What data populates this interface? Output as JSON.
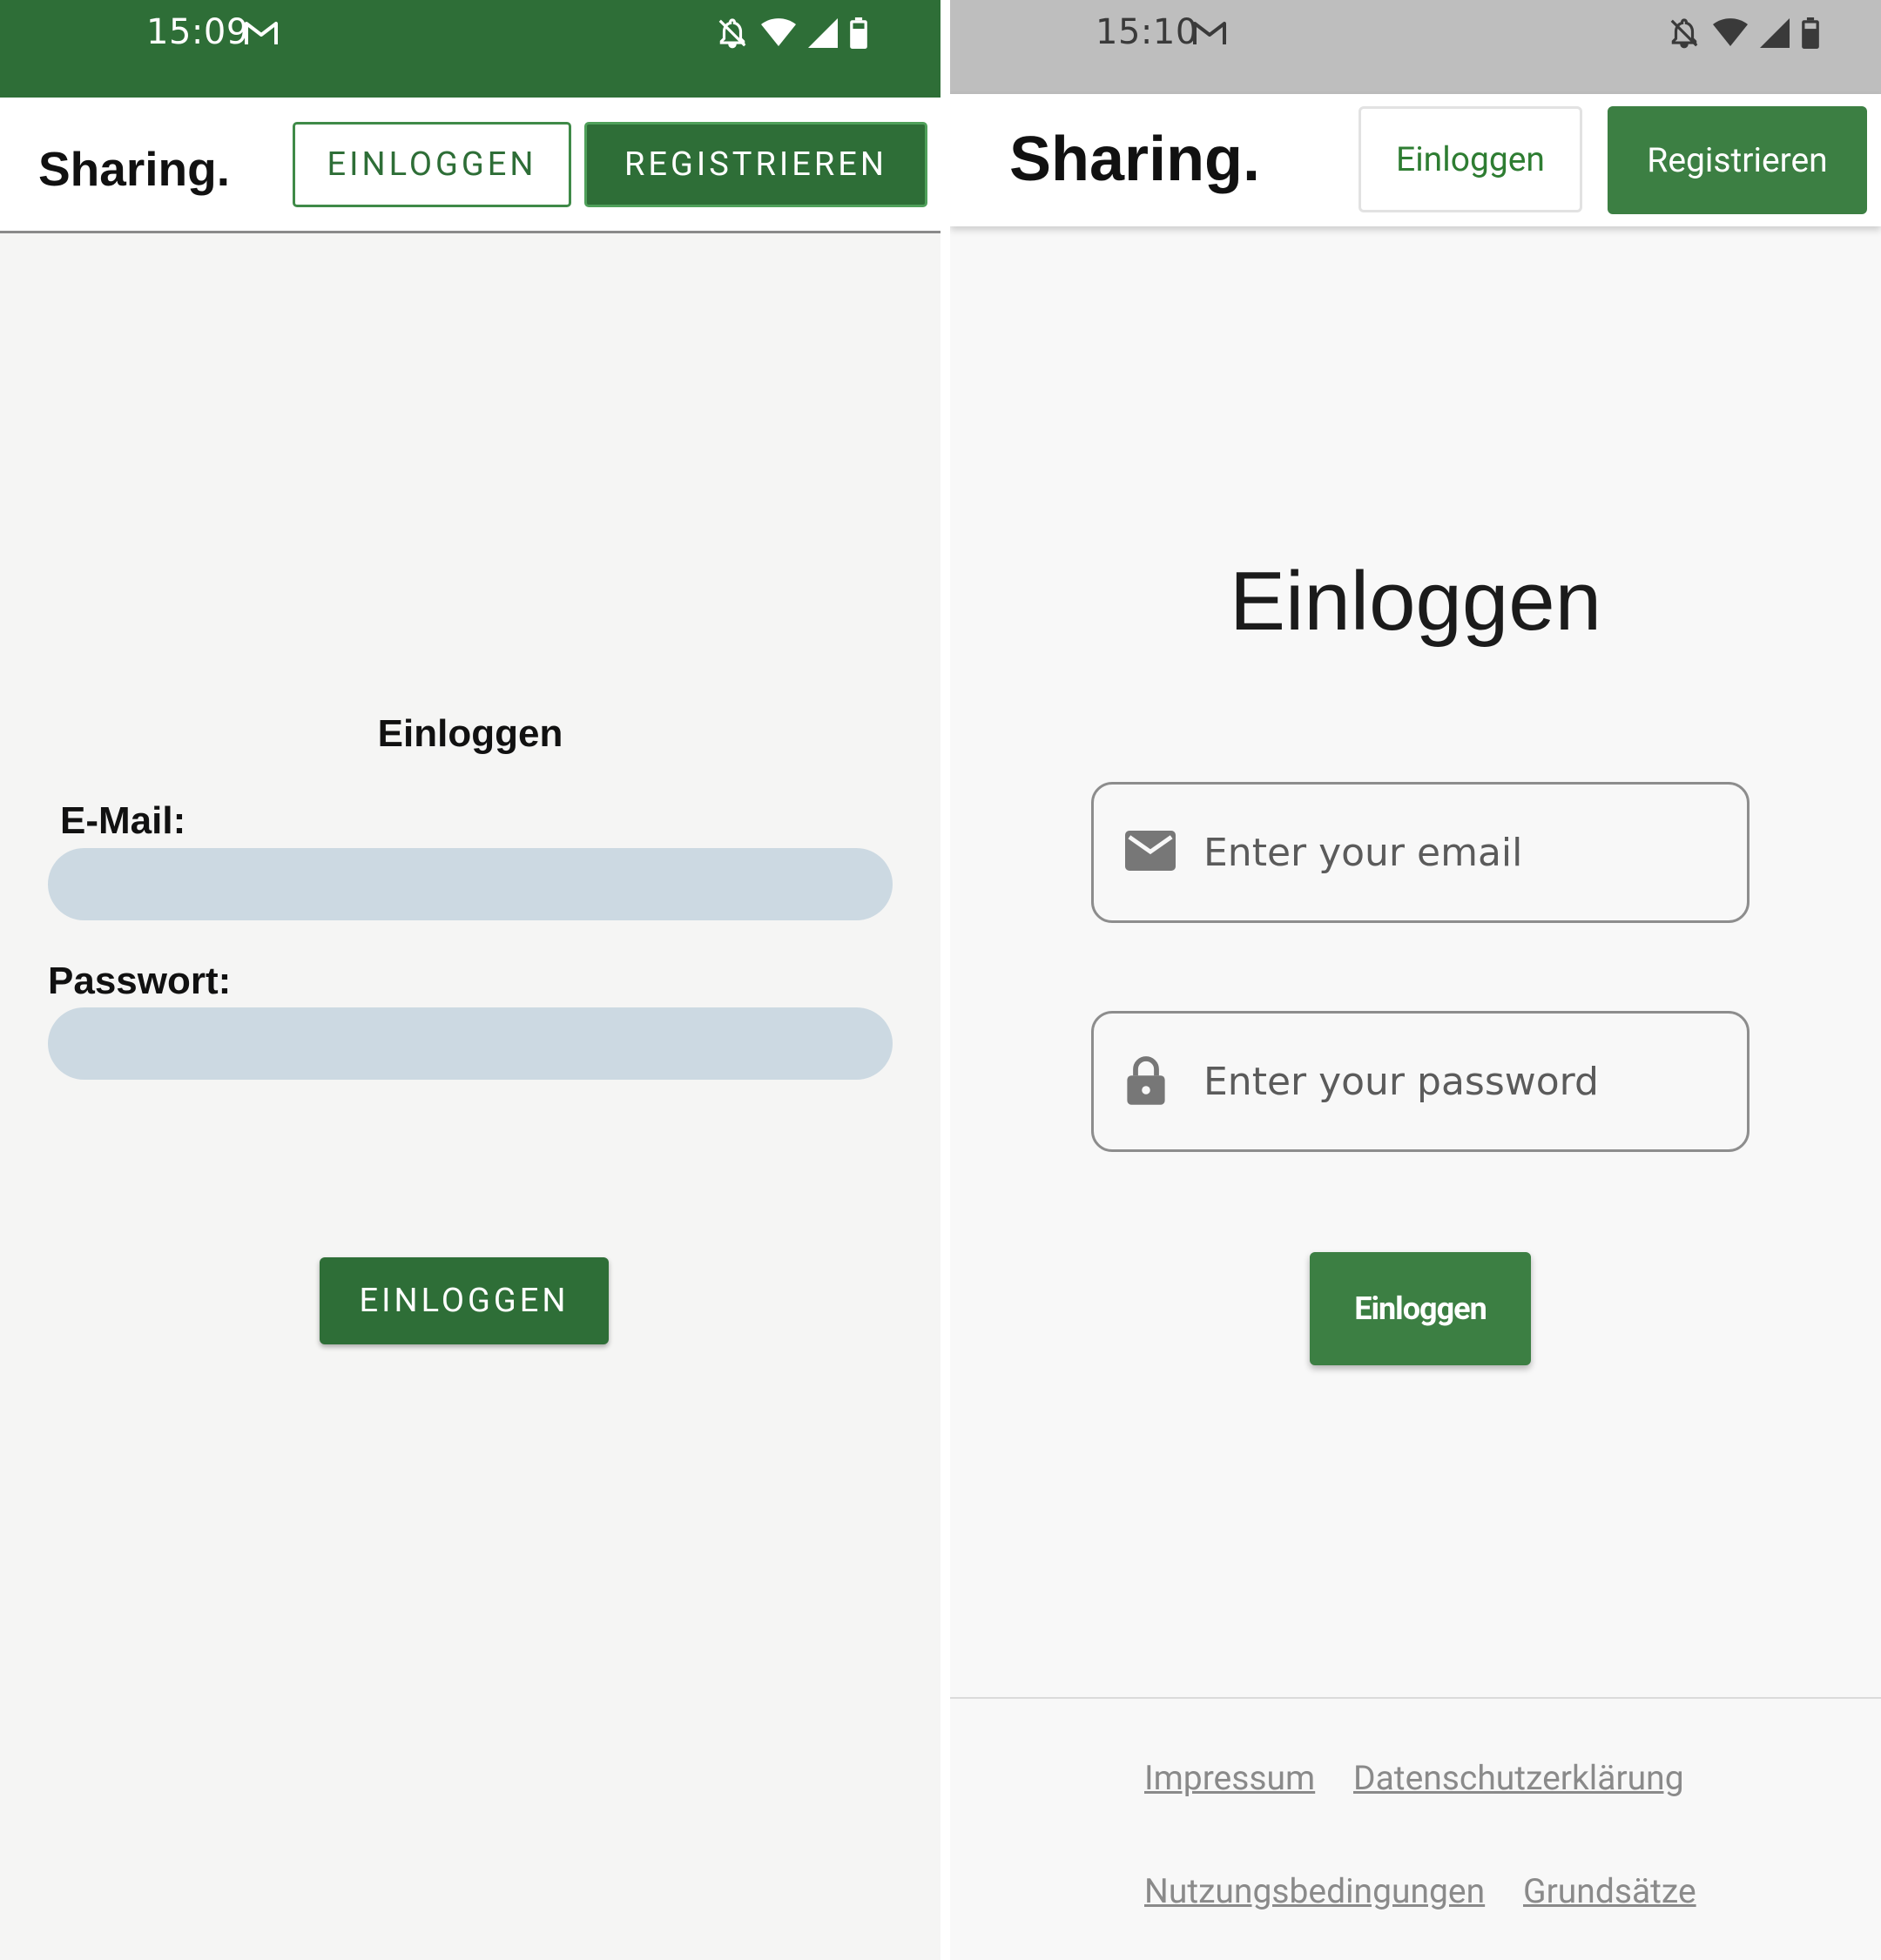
{
  "left": {
    "status_bar": {
      "time": "15:09",
      "icons": [
        "gmail-icon",
        "bell-off-icon",
        "wifi-icon",
        "cell-signal-icon",
        "battery-icon"
      ]
    },
    "app_bar": {
      "logo": "Sharing.",
      "login_button": "EINLOGGEN",
      "register_button": "REGISTRIEREN"
    },
    "form": {
      "title": "Einloggen",
      "email_label": "E-Mail:",
      "email_value": "",
      "password_label": "Passwort:",
      "password_value": "",
      "submit_button": "EINLOGGEN"
    }
  },
  "right": {
    "status_bar": {
      "time": "15:10",
      "icons": [
        "gmail-icon",
        "bell-off-icon",
        "wifi-icon",
        "cell-signal-icon",
        "battery-icon"
      ]
    },
    "app_bar": {
      "logo": "Sharing.",
      "login_button": "Einloggen",
      "register_button": "Registrieren"
    },
    "form": {
      "title": "Einloggen",
      "email_placeholder": "Enter your email",
      "password_placeholder": "Enter your password",
      "submit_button": "Einloggen"
    },
    "footer": {
      "links": [
        "Impressum",
        "Datenschutzerklärung",
        "Nutzungsbedingungen",
        "Grundsätze"
      ]
    }
  },
  "colors": {
    "brand_green": "#2e6e37",
    "brand_green_light": "#3c7f43",
    "input_fill": "#ccd9e2",
    "status_bar_grey": "#bebebe"
  }
}
